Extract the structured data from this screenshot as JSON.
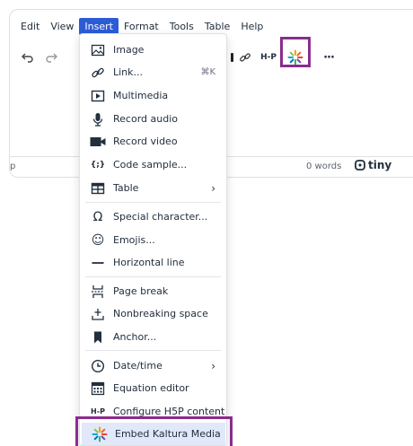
{
  "menubar": {
    "items": [
      "Edit",
      "View",
      "Insert",
      "Format",
      "Tools",
      "Table",
      "Help"
    ],
    "active": "Insert"
  },
  "toolbar": {
    "more_label": "···",
    "h5p_label": "H-P"
  },
  "status": {
    "path": "p",
    "words": "0 words",
    "brand": "tiny"
  },
  "insert_menu": {
    "items": [
      {
        "label": "Image",
        "icon": "image-icon"
      },
      {
        "label": "Link...",
        "icon": "link-icon",
        "shortcut": "⌘K"
      },
      {
        "label": "Multimedia",
        "icon": "multimedia-icon"
      },
      {
        "label": "Record audio",
        "icon": "microphone-icon"
      },
      {
        "label": "Record video",
        "icon": "video-camera-icon"
      },
      {
        "label": "Code sample...",
        "icon": "code-sample-icon",
        "glyph": "{;}"
      },
      {
        "label": "Table",
        "icon": "table-icon",
        "submenu": "›"
      },
      {
        "label": "Special character...",
        "icon": "omega-icon",
        "glyph": "Ω"
      },
      {
        "label": "Emojis...",
        "icon": "emoji-icon",
        "glyph": "☺"
      },
      {
        "label": "Horizontal line",
        "icon": "horizontal-line-icon"
      },
      {
        "label": "Page break",
        "icon": "page-break-icon"
      },
      {
        "label": "Nonbreaking space",
        "icon": "nonbreaking-space-icon"
      },
      {
        "label": "Anchor...",
        "icon": "bookmark-icon"
      },
      {
        "label": "Date/time",
        "icon": "clock-icon",
        "submenu": "›"
      },
      {
        "label": "Equation editor",
        "icon": "equation-editor-icon"
      },
      {
        "label": "Configure H5P content",
        "icon": "h5p-icon",
        "glyph": "H-P"
      },
      {
        "label": "Embed Kaltura Media",
        "icon": "kaltura-icon"
      }
    ]
  },
  "colors": {
    "accent": "#2c5bd6",
    "highlight_border": "#8b2c8f",
    "selected_bg": "#e0e8fa"
  }
}
